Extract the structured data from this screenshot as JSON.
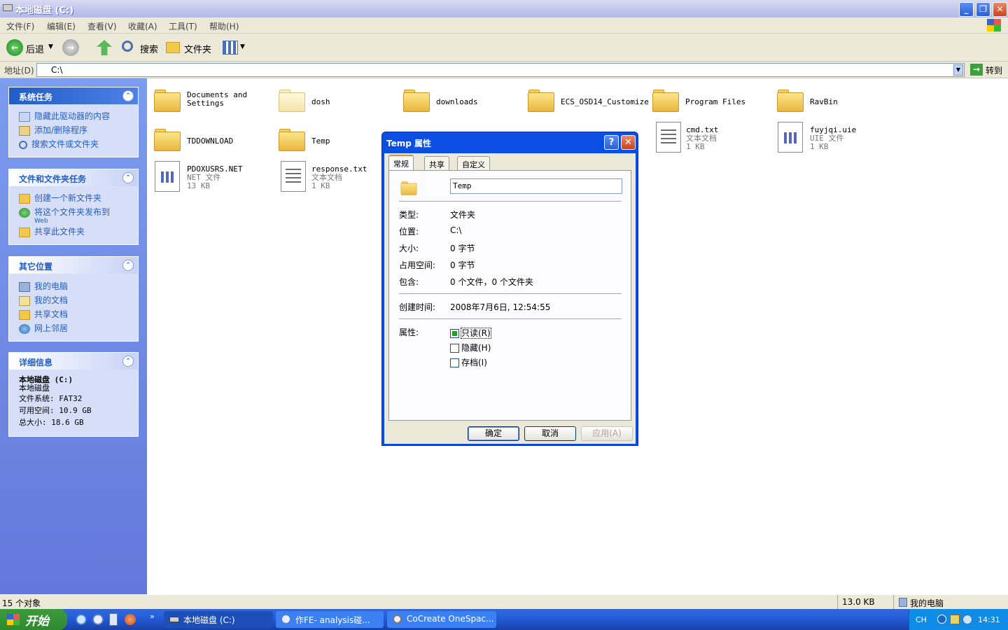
{
  "window": {
    "title": "本地磁盘 (C:)"
  },
  "menu": [
    "文件(F)",
    "编辑(E)",
    "查看(V)",
    "收藏(A)",
    "工具(T)",
    "帮助(H)"
  ],
  "toolbar": {
    "back": "后退",
    "search": "搜索",
    "folders": "文件夹"
  },
  "address": {
    "label": "地址(D)",
    "value": "C:\\",
    "go": "转到"
  },
  "left": {
    "system_tasks": {
      "title": "系统任务",
      "items": [
        "隐藏此驱动器的内容",
        "添加/删除程序",
        "搜索文件或文件夹"
      ]
    },
    "file_tasks": {
      "title": "文件和文件夹任务",
      "items": [
        "创建一个新文件夹",
        "将这个文件夹发布到",
        "Web",
        "共享此文件夹"
      ]
    },
    "other_places": {
      "title": "其它位置",
      "items": [
        "我的电脑",
        "我的文档",
        "共享文档",
        "网上邻居"
      ]
    },
    "details": {
      "title": "详细信息",
      "name": "本地磁盘 (C:)",
      "type": "本地磁盘",
      "fs": "文件系统: FAT32",
      "free": "可用空间: 10.9 GB",
      "total": "总大小: 18.6 GB"
    }
  },
  "files": {
    "documents": "Documents and Settings",
    "dosh": "dosh",
    "downloads": "downloads",
    "ecs": "ECS_OSD14_Customize",
    "program": "Program Files",
    "ravbin": "RavBin",
    "tddownload": "TDDOWNLOAD",
    "temp": "Temp",
    "cmd": {
      "name": "cmd.txt",
      "type": "文本文档",
      "size": "1 KB"
    },
    "fuyjqi": {
      "name": "fuyjqi.uie",
      "type": "UIE 文件",
      "size": "1 KB"
    },
    "pdox": {
      "name": "PDOXUSRS.NET",
      "type": "NET 文件",
      "size": "13 KB"
    },
    "response": {
      "name": "response.txt",
      "type": "文本文档",
      "size": "1 KB"
    }
  },
  "dialog": {
    "title": "Temp 属性",
    "help": "?",
    "tabs": [
      "常规",
      "共享",
      "自定义"
    ],
    "name": "Temp",
    "type_l": "类型:",
    "type_v": "文件夹",
    "loc_l": "位置:",
    "loc_v": "C:\\",
    "size_l": "大小:",
    "size_v": "0 字节",
    "disk_l": "占用空间:",
    "disk_v": "0 字节",
    "contains_l": "包含:",
    "contains_v": "0 个文件，0 个文件夹",
    "created_l": "创建时间:",
    "created_v": "2008年7月6日, 12:54:55",
    "attr_l": "属性:",
    "attrs": [
      "只读(R)",
      "隐藏(H)",
      "存档(I)"
    ],
    "ok": "确定",
    "cancel": "取消",
    "apply": "应用(A)"
  },
  "status": {
    "count": "15 个对象",
    "size": "13.0 KB",
    "location": "我的电脑"
  },
  "taskbar": {
    "start": "开始",
    "tasks": [
      "本地磁盘 (C:)",
      "作FE- analysis碰...",
      "CoCreate OneSpac..."
    ],
    "lang": "CH",
    "time": "14:31"
  }
}
